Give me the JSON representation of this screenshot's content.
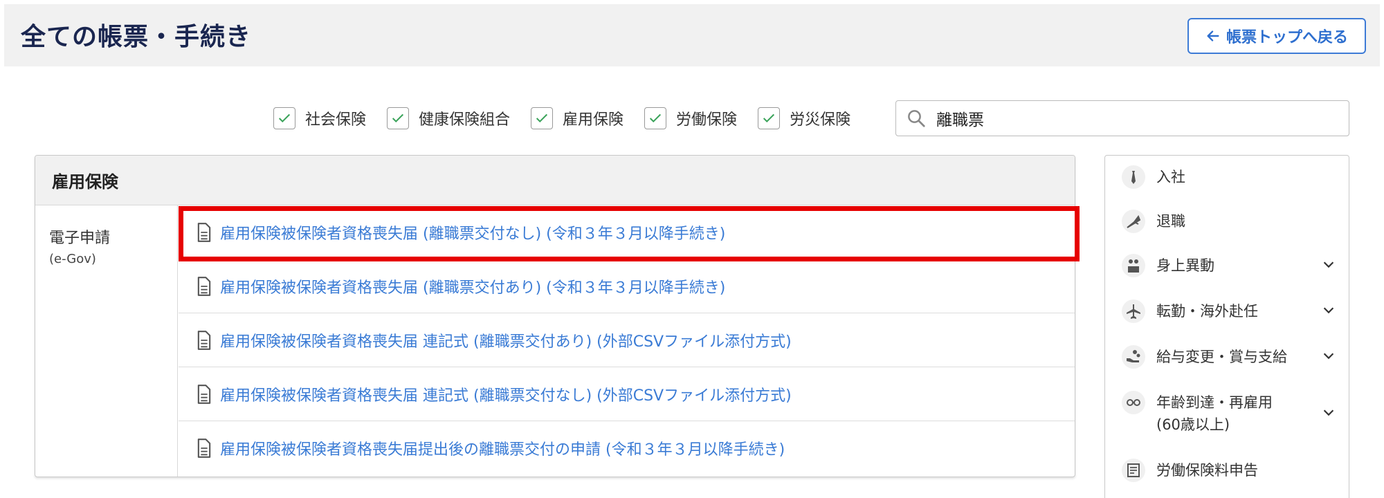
{
  "header": {
    "title": "全ての帳票・手続き",
    "back_label": "帳票トップへ戻る"
  },
  "filters": [
    {
      "label": "社会保険",
      "checked": true
    },
    {
      "label": "健康保険組合",
      "checked": true
    },
    {
      "label": "雇用保険",
      "checked": true
    },
    {
      "label": "労働保険",
      "checked": true
    },
    {
      "label": "労災保険",
      "checked": true
    }
  ],
  "search": {
    "value": "離職票"
  },
  "panel": {
    "title": "雇用保険",
    "category": {
      "name": "電子申請",
      "sub": "(e-Gov)"
    },
    "rows": [
      {
        "label": "雇用保険被保険者資格喪失届 (離職票交付なし) (令和３年３月以降手続き)"
      },
      {
        "label": "雇用保険被保険者資格喪失届 (離職票交付あり) (令和３年３月以降手続き)"
      },
      {
        "label": "雇用保険被保険者資格喪失届 連記式 (離職票交付あり) (外部CSVファイル添付方式)"
      },
      {
        "label": "雇用保険被保険者資格喪失届 連記式 (離職票交付なし) (外部CSVファイル添付方式)"
      },
      {
        "label": "雇用保険被保険者資格喪失届提出後の離職票交付の申請 (令和３年３月以降手続き)"
      }
    ]
  },
  "sidebar": {
    "items": [
      {
        "label": "入社",
        "icon": "tie-icon",
        "expandable": false
      },
      {
        "label": "退職",
        "icon": "flowers-icon",
        "expandable": false
      },
      {
        "label": "身上異動",
        "icon": "people-icon",
        "expandable": true
      },
      {
        "label": "転勤・海外赴任",
        "icon": "airplane-icon",
        "expandable": true
      },
      {
        "label": "給与変更・賞与支給",
        "icon": "money-hand-icon",
        "expandable": true
      },
      {
        "label": "年齢到達・再雇用",
        "sub": "(60歳以上)",
        "icon": "glasses-icon",
        "expandable": true
      },
      {
        "label": "労働保険料申告",
        "icon": "document-icon",
        "expandable": false
      }
    ]
  },
  "colors": {
    "accent": "#3a7bd5",
    "highlight": "#e60000",
    "title": "#1a2650",
    "check": "#3aa35a"
  }
}
